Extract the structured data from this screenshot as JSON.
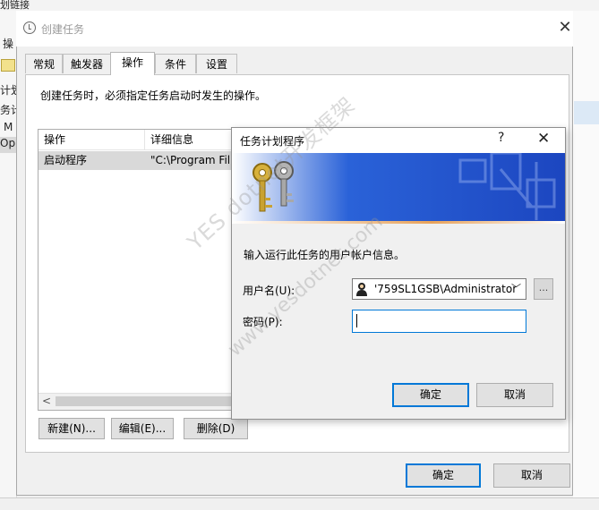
{
  "background": {
    "top_text": "划链接",
    "left_texts": [
      "操",
      "计划",
      "务计",
      "M",
      "Op"
    ]
  },
  "main_dialog": {
    "title": "创建任务",
    "close_glyph": "✕",
    "tabs": [
      {
        "label": "常规",
        "active": false
      },
      {
        "label": "触发器",
        "active": false
      },
      {
        "label": "操作",
        "active": true
      },
      {
        "label": "条件",
        "active": false
      },
      {
        "label": "设置",
        "active": false
      }
    ],
    "description": "创建任务时，必须指定任务启动时发生的操作。",
    "list": {
      "columns": [
        "操作",
        "详细信息"
      ],
      "rows": [
        {
          "action": "启动程序",
          "details": "\"C:\\Program Fil"
        }
      ],
      "scroll_left_glyph": "<"
    },
    "buttons": {
      "new": "新建(N)...",
      "edit": "编辑(E)...",
      "delete": "删除(D)",
      "ok": "确定",
      "cancel": "取消"
    }
  },
  "cred_dialog": {
    "title": "任务计划程序",
    "help_glyph": "?",
    "close_glyph": "✕",
    "prompt": "输入运行此任务的用户帐户信息。",
    "username_label": "用户名(U):",
    "username_value": "'759SL1GSB\\Administrator",
    "browse_label": "...",
    "password_label": "密码(P):",
    "password_value": "",
    "ok": "确定",
    "cancel": "取消"
  },
  "watermark": {
    "line1": "YES dotnet开发框架",
    "line2": "www.yesdotnet.com"
  },
  "colors": {
    "accent": "#0078d7",
    "banner_blue": "#1e4fc8",
    "selected_row": "#d9d9d9"
  }
}
